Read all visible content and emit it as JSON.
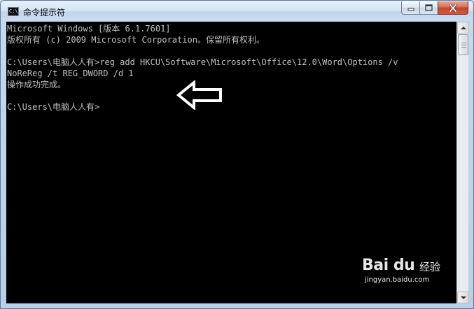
{
  "window": {
    "title": "命令提示符",
    "icon_text": "C:\\"
  },
  "console": {
    "lines": [
      "Microsoft Windows [版本 6.1.7601]",
      "版权所有 (c) 2009 Microsoft Corporation。保留所有权利。",
      "",
      "C:\\Users\\电脑人人有>reg add HKCU\\Software\\Microsoft\\Office\\12.0\\Word\\Options /v",
      "NoReReg /t REG_DWORD /d 1",
      "操作成功完成。",
      "",
      "C:\\Users\\电脑人人有>"
    ]
  },
  "watermark": {
    "logo": "Bai du",
    "sub": "经验",
    "url": "jingyan.baidu.com"
  },
  "colors": {
    "console_bg": "#000000",
    "console_text": "#c0c0c0",
    "close_button": "#c2432a"
  }
}
